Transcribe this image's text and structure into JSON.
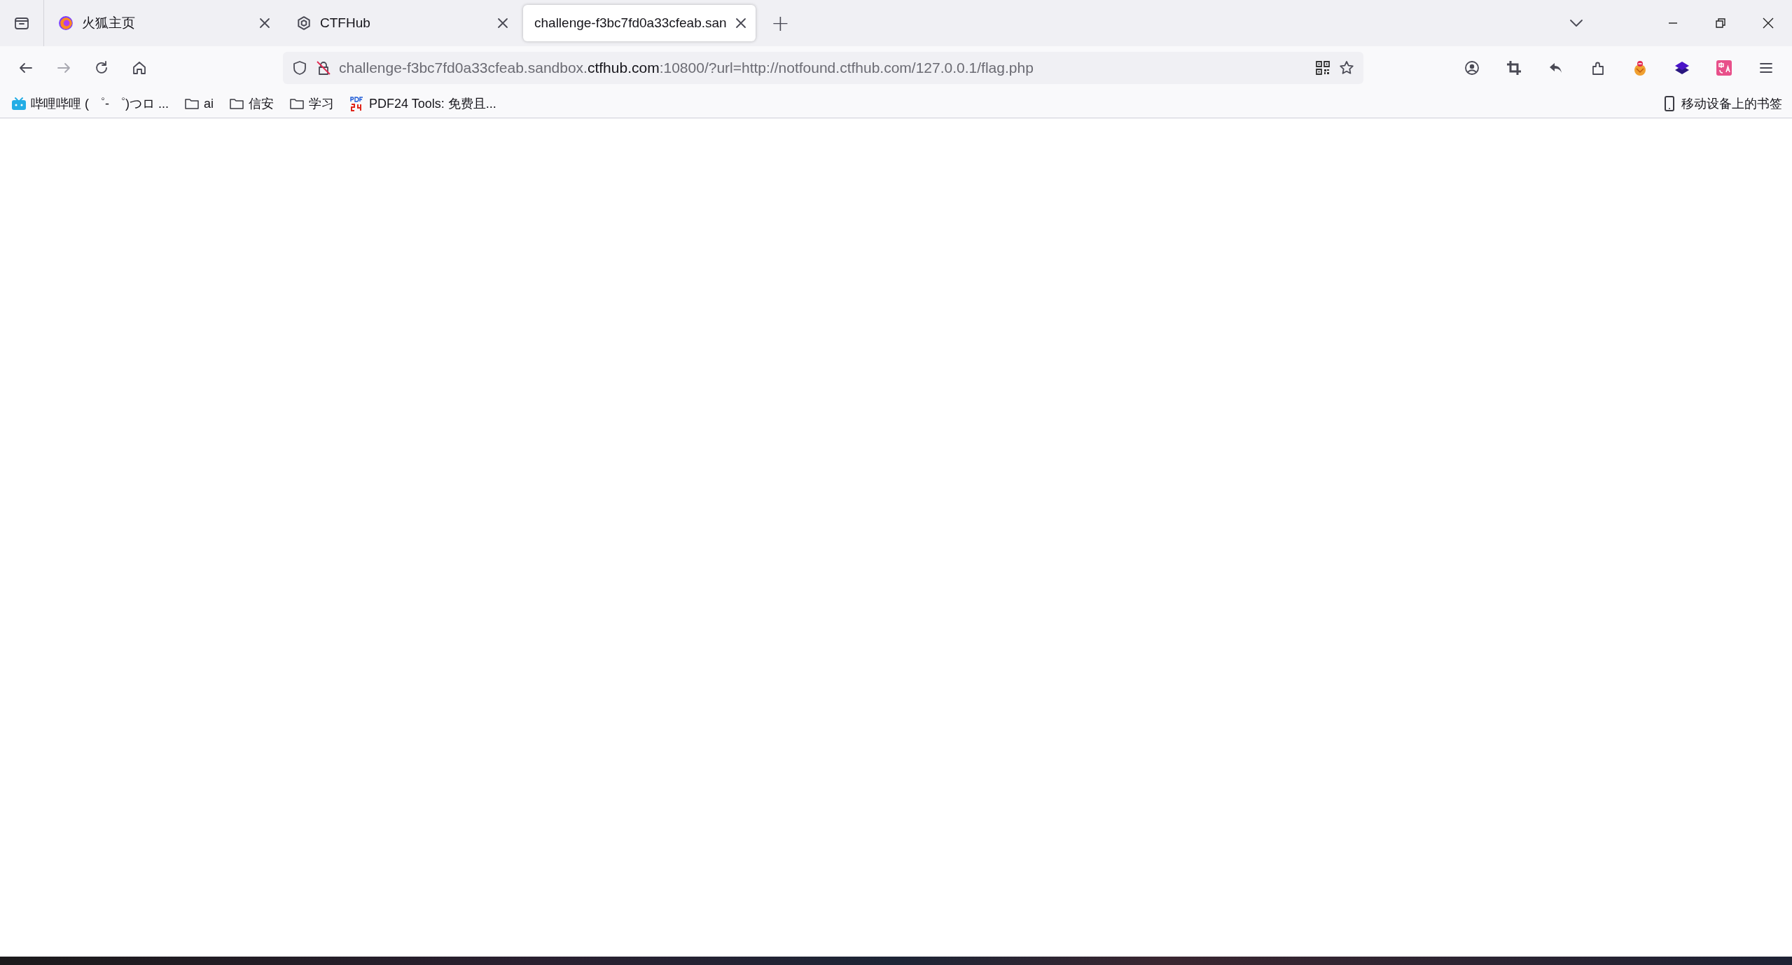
{
  "tabs": [
    {
      "label": "火狐主页",
      "selected": false
    },
    {
      "label": "CTFHub",
      "selected": false
    },
    {
      "label": "challenge-f3bc7fd0a33cfeab.san",
      "selected": true
    }
  ],
  "new_tab": "+",
  "address_bar": {
    "prefix": "challenge-f3bc7fd0a33cfeab.sandbox.",
    "domain": "ctfhub.com",
    "suffix": ":10800/?url=http://notfound.ctfhub.com/127.0.0.1/flag.php"
  },
  "bookmarks": [
    {
      "kind": "site",
      "label": "哔哩哔哩 ( ゜- ゜)つロ ..."
    },
    {
      "kind": "folder",
      "label": "ai"
    },
    {
      "kind": "folder",
      "label": "信安"
    },
    {
      "kind": "folder",
      "label": "学习"
    },
    {
      "kind": "site",
      "label": "PDF24 Tools: 免费且..."
    }
  ],
  "mobile_bookmarks": "移动设备上的书签"
}
